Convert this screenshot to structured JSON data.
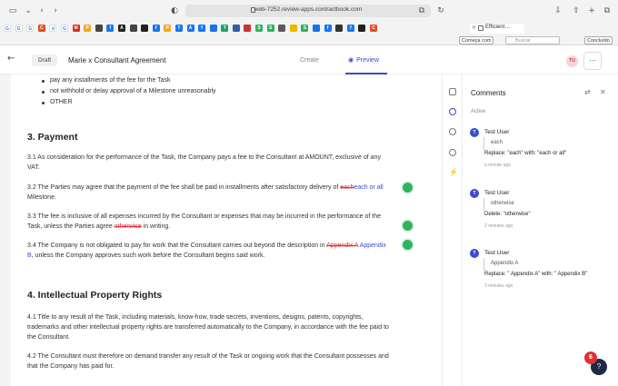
{
  "browser": {
    "url": "web-7252.review-apps.contractbook.com",
    "tab_title": "Efficient…",
    "comece_label": "Começa com",
    "search_placeholder": "Buscar",
    "concluido_label": "Concluído",
    "bookmarks": [
      {
        "letter": "G",
        "color": "#ffffff"
      },
      {
        "letter": "G",
        "color": "#ffffff"
      },
      {
        "letter": "G",
        "color": "#ffffff"
      },
      {
        "letter": "C",
        "color": "#e04f1f"
      },
      {
        "letter": "d",
        "color": "#ffffff"
      },
      {
        "letter": "G",
        "color": "#ffffff"
      },
      {
        "letter": "M",
        "color": "#d93025"
      },
      {
        "letter": "P",
        "color": "#f5a623"
      },
      {
        "letter": "",
        "color": "#444444"
      },
      {
        "letter": "f",
        "color": "#1877f2"
      },
      {
        "letter": "A",
        "color": "#222222"
      },
      {
        "letter": "",
        "color": "#444444"
      },
      {
        "letter": "",
        "color": "#222222"
      },
      {
        "letter": "f",
        "color": "#1877f2"
      },
      {
        "letter": "P",
        "color": "#f5a623"
      },
      {
        "letter": "f",
        "color": "#1877f2"
      },
      {
        "letter": "A",
        "color": "#1877f2"
      },
      {
        "letter": "f",
        "color": "#1877f2"
      },
      {
        "letter": "",
        "color": "#1a73e8"
      },
      {
        "letter": "T",
        "color": "#22a06b"
      },
      {
        "letter": "",
        "color": "#2f5fa8"
      },
      {
        "letter": "",
        "color": "#cc3333"
      },
      {
        "letter": "S",
        "color": "#2fb35c"
      },
      {
        "letter": "S",
        "color": "#2fb35c"
      },
      {
        "letter": "",
        "color": "#5a5a5a"
      },
      {
        "letter": "",
        "color": "#f1b400"
      },
      {
        "letter": "S",
        "color": "#2fb35c"
      },
      {
        "letter": "",
        "color": "#1a73e8"
      },
      {
        "letter": "f",
        "color": "#1877f2"
      },
      {
        "letter": "",
        "color": "#333333"
      },
      {
        "letter": "f",
        "color": "#1877f2"
      },
      {
        "letter": "",
        "color": "#222222"
      },
      {
        "letter": "C",
        "color": "#e04f1f"
      }
    ]
  },
  "header": {
    "status": "Draft",
    "title": "Marie x Consultant Agreement",
    "create_label": "Create",
    "preview_label": "Preview",
    "user_initials": "TU"
  },
  "document": {
    "bullets": [
      "pay any installments of the fee for the Task",
      "not withhold or delay approval of a Milestone unreasonably",
      "OTHER"
    ],
    "section3_title": "3. Payment",
    "p3_1": "3.1 As consideration for the performance of the Task, the Company pays a fee to the Consultant at AMOUNT, exclusive of any VAT.",
    "p3_2_pre": "3.2 The Parties may agree that the payment of the fee shall be paid in installments after satisfactory delivery of ",
    "p3_2_del": "each",
    "p3_2_ins": "each or all",
    "p3_2_post": " Milestone.",
    "p3_3_pre": "3.3 The fee is inclusive of all expenses incurred by the Consultant or expenses that may be incurred in the performance of the Task, unless the Parties agree ",
    "p3_3_del": "otherwise",
    "p3_3_post": " in writing.",
    "p3_4_pre": "3.4 The Company is not obligated to pay for work that the Consultant carries out beyond the description in ",
    "p3_4_del": "Appendix A",
    "p3_4_ins": "Appendix B",
    "p3_4_post": ", unless the Company approves such work before the Consultant begins said work.",
    "section4_title": "4. Intellectual Property Rights",
    "p4_1": "4.1 Title to any result of the Task, including materials, know-how, trade secrets, inventions, designs, patents, copyrights, trademarks and other intellectual property rights are transferred automatically to the Company, in accordance with the fee paid to the Consultant.",
    "p4_2": "4.2 The Consultant must therefore on demand transfer any result of the Task or ongoing work that the Consultant possesses and that the Company has paid for."
  },
  "comments_panel": {
    "title": "Comments",
    "filter_tab": "Active",
    "items": [
      {
        "initial": "T",
        "user": "Test User",
        "quote": "each",
        "action": "Replace: \"each\" with: \"each or all\"",
        "time": "a minute ago"
      },
      {
        "initial": "T",
        "user": "Test User",
        "quote": "otherwise",
        "action": "Delete: \"otherwise\"",
        "time": "2 minutes ago"
      },
      {
        "initial": "T",
        "user": "Test User",
        "quote": "Appendix A",
        "action": "Replace: \" Appendix A\" with: \" Appendix B\"",
        "time": "3 minutes ago"
      }
    ]
  },
  "notifications": {
    "count": "6"
  },
  "help": {
    "label": "?"
  }
}
